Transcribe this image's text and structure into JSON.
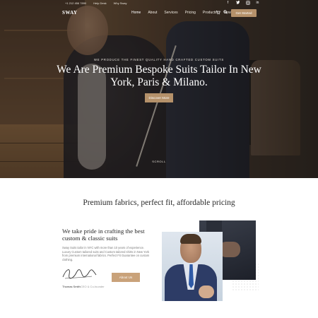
{
  "topbar": {
    "phone": "+1 212 456 7890",
    "help_link": "Help Desk",
    "why_link": "Why Sway",
    "socials": [
      "f",
      "t",
      "ig",
      "in"
    ]
  },
  "nav": {
    "logo": "SWAY",
    "items": [
      "Home",
      "About",
      "Services",
      "Pricing",
      "Products",
      "News"
    ],
    "active": "Home",
    "cta": "Get Started"
  },
  "hero": {
    "kicker": "WE PRODUCE THE FINEST QUALITY HAND CRAFTED CUSTOM SUITS",
    "title": "We Are Premium Bespoke Suits Tailor In New York, Paris & Milano.",
    "button": "Discover More",
    "scroll": "SCROLL"
  },
  "tagline": "Premium fabrics, perfect fit, affordable pricing",
  "about": {
    "title": "We take pride in crafting the best custom & classic suits",
    "text": "Sway Suits tailor in NYC with more than 10 years of experience. Luxury Custom tailored suits and Custom tailored shirts in New York from premium international fabrics. Perfect Fit Guarantee on custom clothing.",
    "signature_name": "Thomas Smith",
    "signature_role": "CEO & Co-founder",
    "button": "About Us"
  },
  "colors": {
    "accent": "#b5916a",
    "button_light": "#c9a27a",
    "heading": "#262626"
  }
}
